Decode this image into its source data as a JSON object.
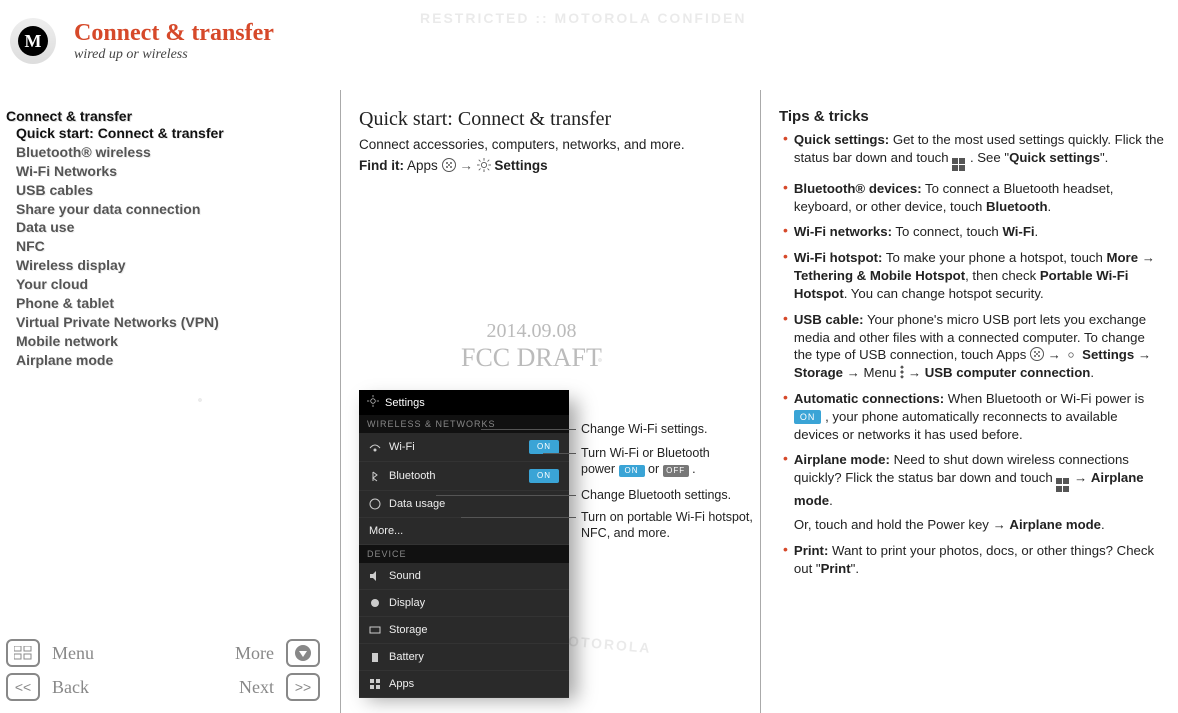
{
  "header": {
    "title": "Connect & transfer",
    "subtitle": "wired up or wireless"
  },
  "toc": {
    "heading": "Connect & transfer",
    "items": [
      "Quick start: Connect & transfer",
      "Bluetooth® wireless",
      "Wi-Fi Networks",
      "USB cables",
      "Share your data connection",
      "Data use",
      "NFC",
      "Wireless display",
      "Your cloud",
      "Phone & tablet",
      "Virtual Private Networks (VPN)",
      "Mobile network",
      "Airplane mode"
    ]
  },
  "mid": {
    "heading": "Quick start: Connect & transfer",
    "intro": "Connect accessories, computers, networks, and more.",
    "findit_prefix": "Find it:",
    "findit_apps": "Apps",
    "findit_settings": "Settings",
    "draft_date": "2014.09.08",
    "draft_label": "FCC DRAFT"
  },
  "phone": {
    "title": "Settings",
    "section1": "WIRELESS & NETWORKS",
    "rows1": [
      {
        "label": "Wi-Fi",
        "toggle": "ON"
      },
      {
        "label": "Bluetooth",
        "toggle": "ON"
      },
      {
        "label": "Data usage",
        "toggle": ""
      },
      {
        "label": "More...",
        "toggle": ""
      }
    ],
    "section2": "DEVICE",
    "rows2": [
      "Sound",
      "Display",
      "Storage",
      "Battery",
      "Apps"
    ]
  },
  "callouts": {
    "c1": "Change Wi-Fi settings.",
    "c2a": "Turn Wi-Fi or Bluetooth",
    "c2b_power": "power",
    "c2b_on": "ON",
    "c2b_or": "or",
    "c2b_off": "OFF",
    "c2b_dot": ".",
    "c3": "Change Bluetooth settings.",
    "c4": "Turn on portable Wi-Fi hotspot, NFC, and more."
  },
  "tips": {
    "heading": "Tips & tricks",
    "t1a": "Quick settings:",
    "t1b": " Get to the most used settings quickly. Flick the status bar down and touch ",
    "t1c": ". See \"",
    "t1d": "Quick settings",
    "t1e": "\".",
    "t2a": "Bluetooth® devices:",
    "t2b": " To connect a Bluetooth headset, keyboard, or other device, touch ",
    "t2c": "Bluetooth",
    "t2d": ".",
    "t3a": "Wi-Fi networks:",
    "t3b": " To connect, touch ",
    "t3c": "Wi-Fi",
    "t3d": ".",
    "t4a": "Wi-Fi hotspot:",
    "t4b": " To make your phone a hotspot, touch ",
    "t4c": "More",
    "t4d": " → ",
    "t4e": "Tethering & Mobile Hotspot",
    "t4f": ", then check ",
    "t4g": "Portable Wi-Fi Hotspot",
    "t4h": ". You can change hotspot security.",
    "t5a": "USB cable:",
    "t5b": " Your phone's micro USB port lets you exchange media and other files with a connected computer. To change the type of USB connection, touch Apps ",
    "t5c": " → ",
    "t5d": "Settings",
    "t5e": " → ",
    "t5f": "Storage",
    "t5g": " → Menu ",
    "t5h": " → ",
    "t5i": "USB computer connection",
    "t5j": ".",
    "t6a": "Automatic connections:",
    "t6b": " When Bluetooth or Wi-Fi power is ",
    "t6c": "ON",
    "t6d": ", your phone automatically reconnects to available devices or networks it has used before.",
    "t7a": "Airplane mode:",
    "t7b": " Need to shut down wireless connections quickly? Flick the status bar down and touch ",
    "t7c": " → ",
    "t7d": "Airplane mode",
    "t7e": ".",
    "t7f": "Or, touch and hold the Power key → ",
    "t7g": "Airplane mode",
    "t7h": ".",
    "t8a": "Print:",
    "t8b": " Want to print your photos, docs, or other things? Check out \"",
    "t8c": "Print",
    "t8d": "\"."
  },
  "footer": {
    "menu": "Menu",
    "more": "More",
    "back": "Back",
    "next": "Next"
  }
}
